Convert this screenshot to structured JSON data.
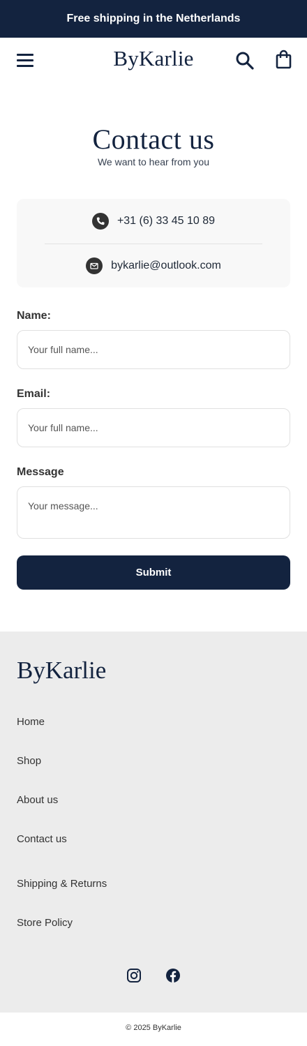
{
  "announcement": {
    "text": "Free shipping in the Netherlands"
  },
  "header": {
    "logo": "ByKarlie",
    "menu_icon": "hamburger-menu-icon",
    "search_icon": "search-icon",
    "cart_icon": "shopping-bag-icon"
  },
  "page": {
    "title": "Contact us",
    "subtitle": "We want to hear from you"
  },
  "contact_info": {
    "phone": {
      "icon": "phone-icon",
      "text": "+31 (6) 33 45 10 89"
    },
    "email": {
      "icon": "mail-icon",
      "text": "bykarlie@outlook.com"
    }
  },
  "form": {
    "name_label": "Name:",
    "name_placeholder": "Your full name...",
    "email_label": "Email:",
    "email_placeholder": "Your full name...",
    "message_label": "Message",
    "message_placeholder": "Your message...",
    "submit_label": "Submit"
  },
  "footer": {
    "logo": "ByKarlie",
    "links": [
      "Home",
      "Shop",
      "About us",
      "Contact us",
      "Shipping & Returns",
      "Store Policy"
    ],
    "social": [
      {
        "icon": "instagram-icon"
      },
      {
        "icon": "facebook-icon"
      }
    ],
    "copyright": "© 2025 ByKarlie"
  },
  "colors": {
    "brand_navy": "#13233f",
    "footer_bg": "#ececec",
    "card_bg": "#f8f8f8",
    "icon_circle": "#333333"
  }
}
